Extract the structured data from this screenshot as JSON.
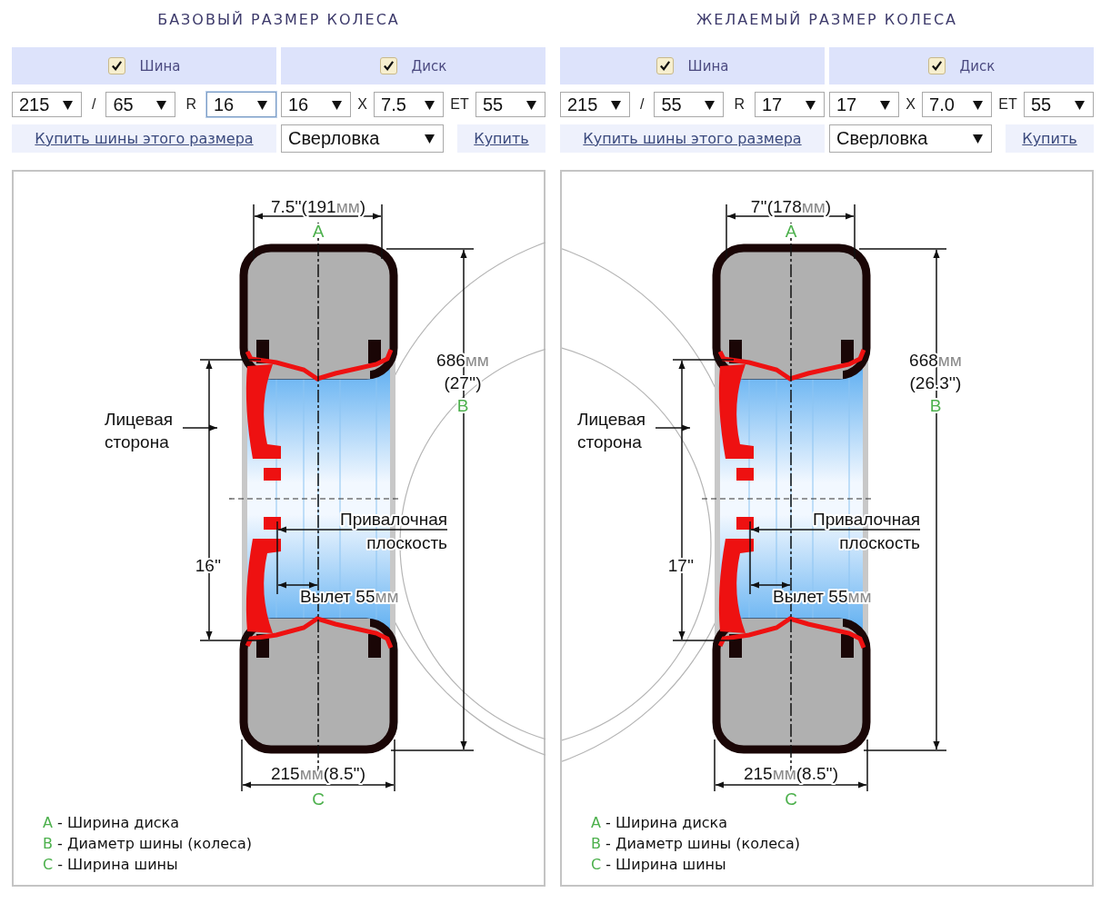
{
  "panels": [
    {
      "title": "БАЗОВЫЙ РАЗМЕР КОЛЕСА",
      "tire": {
        "checkbox": {
          "label": "Шина",
          "checked": true
        },
        "fields": [
          {
            "kind": "select",
            "value": "215",
            "focused": false
          },
          {
            "kind": "separator",
            "text": "/"
          },
          {
            "kind": "select",
            "value": "65",
            "focused": false
          },
          {
            "kind": "separator",
            "text": "R"
          },
          {
            "kind": "select",
            "value": "16",
            "focused": true
          }
        ]
      },
      "disk": {
        "checkbox": {
          "label": "Диск",
          "checked": true
        },
        "fields": [
          {
            "kind": "select",
            "value": "16",
            "focused": false
          },
          {
            "kind": "separator",
            "text": "X"
          },
          {
            "kind": "select",
            "value": "7.5",
            "focused": false
          },
          {
            "kind": "separator",
            "text": "ET"
          },
          {
            "kind": "select",
            "value": "55",
            "focused": false
          }
        ]
      },
      "buy_tires_link": "Купить шины этого размера",
      "drilling_select": {
        "value": "Сверловка"
      },
      "buy_link": "Купить",
      "diagram": {
        "rim_width": [
          {
            "text": "7.5''(191",
            "muted": false
          },
          {
            "text": "мм",
            "muted": true
          },
          {
            "text": ")",
            "muted": false
          }
        ],
        "letter_a": "A",
        "diameter": [
          {
            "text": "686",
            "muted": false
          },
          {
            "text": "мм",
            "muted": true
          }
        ],
        "diameter_inches": "(27'')",
        "letter_b": "B",
        "rim_diameter": "16''",
        "face_side": [
          "Лицевая",
          "сторона"
        ],
        "mounting_plane": [
          "Привалочная",
          "плоскость"
        ],
        "offset": [
          {
            "text": "Вылет 55",
            "muted": false
          },
          {
            "text": "мм",
            "muted": true
          }
        ],
        "tire_width": [
          {
            "text": "215",
            "muted": false
          },
          {
            "text": "мм",
            "muted": true
          },
          {
            "text": "(8.5'')",
            "muted": false
          }
        ],
        "letter_c": "C"
      },
      "legend": [
        {
          "letter": "A",
          "text": " - Ширина диска"
        },
        {
          "letter": "B",
          "text": " - Диаметр шины (колеса)"
        },
        {
          "letter": "C",
          "text": " - Ширина шины"
        }
      ]
    },
    {
      "title": "ЖЕЛАЕМЫЙ РАЗМЕР КОЛЕСА",
      "tire": {
        "checkbox": {
          "label": "Шина",
          "checked": true
        },
        "fields": [
          {
            "kind": "select",
            "value": "215",
            "focused": false
          },
          {
            "kind": "separator",
            "text": "/"
          },
          {
            "kind": "select",
            "value": "55",
            "focused": false
          },
          {
            "kind": "separator",
            "text": "R"
          },
          {
            "kind": "select",
            "value": "17",
            "focused": false
          }
        ]
      },
      "disk": {
        "checkbox": {
          "label": "Диск",
          "checked": true
        },
        "fields": [
          {
            "kind": "select",
            "value": "17",
            "focused": false
          },
          {
            "kind": "separator",
            "text": "X"
          },
          {
            "kind": "select",
            "value": "7.0",
            "focused": false
          },
          {
            "kind": "separator",
            "text": "ET"
          },
          {
            "kind": "select",
            "value": "55",
            "focused": false
          }
        ]
      },
      "buy_tires_link": "Купить шины этого размера",
      "drilling_select": {
        "value": "Сверловка"
      },
      "buy_link": "Купить",
      "diagram": {
        "rim_width": [
          {
            "text": "7''(178",
            "muted": false
          },
          {
            "text": "мм",
            "muted": true
          },
          {
            "text": ")",
            "muted": false
          }
        ],
        "letter_a": "A",
        "diameter": [
          {
            "text": "668",
            "muted": false
          },
          {
            "text": "мм",
            "muted": true
          }
        ],
        "diameter_inches": "(26.3'')",
        "letter_b": "B",
        "rim_diameter": "17''",
        "face_side": [
          "Лицевая",
          "сторона"
        ],
        "mounting_plane": [
          "Привалочная",
          "плоскость"
        ],
        "offset": [
          {
            "text": "Вылет 55",
            "muted": false
          },
          {
            "text": "мм",
            "muted": true
          }
        ],
        "tire_width": [
          {
            "text": "215",
            "muted": false
          },
          {
            "text": "мм",
            "muted": true
          },
          {
            "text": "(8.5'')",
            "muted": false
          }
        ],
        "letter_c": "C"
      },
      "legend": [
        {
          "letter": "A",
          "text": " - Ширина диска"
        },
        {
          "letter": "B",
          "text": " - Диаметр шины (колеса)"
        },
        {
          "letter": "C",
          "text": " - Ширина шины"
        }
      ]
    }
  ]
}
